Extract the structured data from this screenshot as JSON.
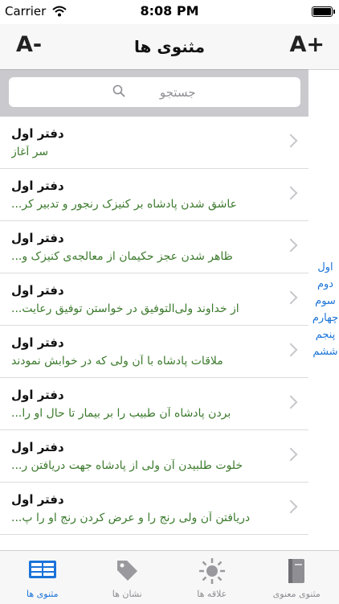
{
  "status": {
    "carrier": "Carrier",
    "time": "8:08 PM"
  },
  "nav": {
    "title": "مثنوی ها",
    "font_decrease": "A-",
    "font_increase": "A+"
  },
  "search": {
    "placeholder": "جستجو"
  },
  "rows": [
    {
      "title": "دفتر اول",
      "subtitle": "سر آغاز"
    },
    {
      "title": "دفتر اول",
      "subtitle": "عاشق شدن پادشاه بر کنیزک رنجور و تدبیر کر..."
    },
    {
      "title": "دفتر اول",
      "subtitle": "ظاهر شدن عجز حکیمان از معالجه‌ی کنیزک و..."
    },
    {
      "title": "دفتر اول",
      "subtitle": "از خداوند ولی‌التوفیق در خواستن توفیق رعایت..."
    },
    {
      "title": "دفتر اول",
      "subtitle": "ملاقات پادشاه با آن ولی که در خوابش نمودند"
    },
    {
      "title": "دفتر اول",
      "subtitle": "بردن پادشاه آن طبیب را بر بیمار تا حال او را..."
    },
    {
      "title": "دفتر اول",
      "subtitle": "خلوت طلبیدن آن ولی از پادشاه جهت دریافتن ر..."
    },
    {
      "title": "دفتر اول",
      "subtitle": "دریافتن آن ولی رنج را و عرض کردن رنج او را پ..."
    }
  ],
  "side_index": [
    "اول",
    "دوم",
    "سوم",
    "چهارم",
    "پنجم",
    "ششم"
  ],
  "tabs": [
    {
      "label": "مثنوی ها",
      "icon": "book-list-icon",
      "active": true
    },
    {
      "label": "نشان ها",
      "icon": "tag-icon",
      "active": false
    },
    {
      "label": "علاقه ها",
      "icon": "sun-icon",
      "active": false
    },
    {
      "label": "مثنوی معنوی",
      "icon": "book-icon",
      "active": false
    }
  ],
  "colors": {
    "accent": "#1a73d9",
    "subtitle_green": "#3c7a2d",
    "chevron": "#c7c7cc"
  }
}
